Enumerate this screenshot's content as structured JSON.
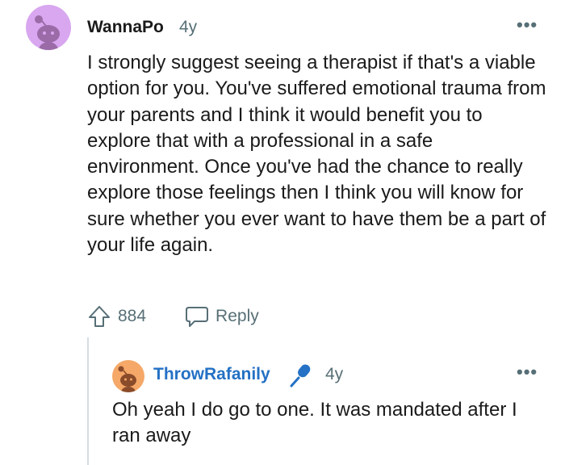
{
  "comment": {
    "author": "WannaPo",
    "age": "4y",
    "more_label": "•••",
    "text": "I strongly suggest seeing a therapist if that's a viable option for you. You've suffered emotional trauma from your parents and I think it would benefit you to explore that with a professional in a safe environment. Once you've had the chance to really explore those feelings then I think you will know for sure whether you ever want to have them be a part of your life again.",
    "score": "884",
    "reply_label": "Reply",
    "avatar_color": "#d8a7f0"
  },
  "reply": {
    "author": "ThrowRafanily",
    "author_color": "#2471c5",
    "badge_icon": "microphone-icon",
    "age": "4y",
    "more_label": "•••",
    "text": "Oh yeah I do go to one. It was mandated after I ran away",
    "avatar_color": "#f5a868"
  }
}
